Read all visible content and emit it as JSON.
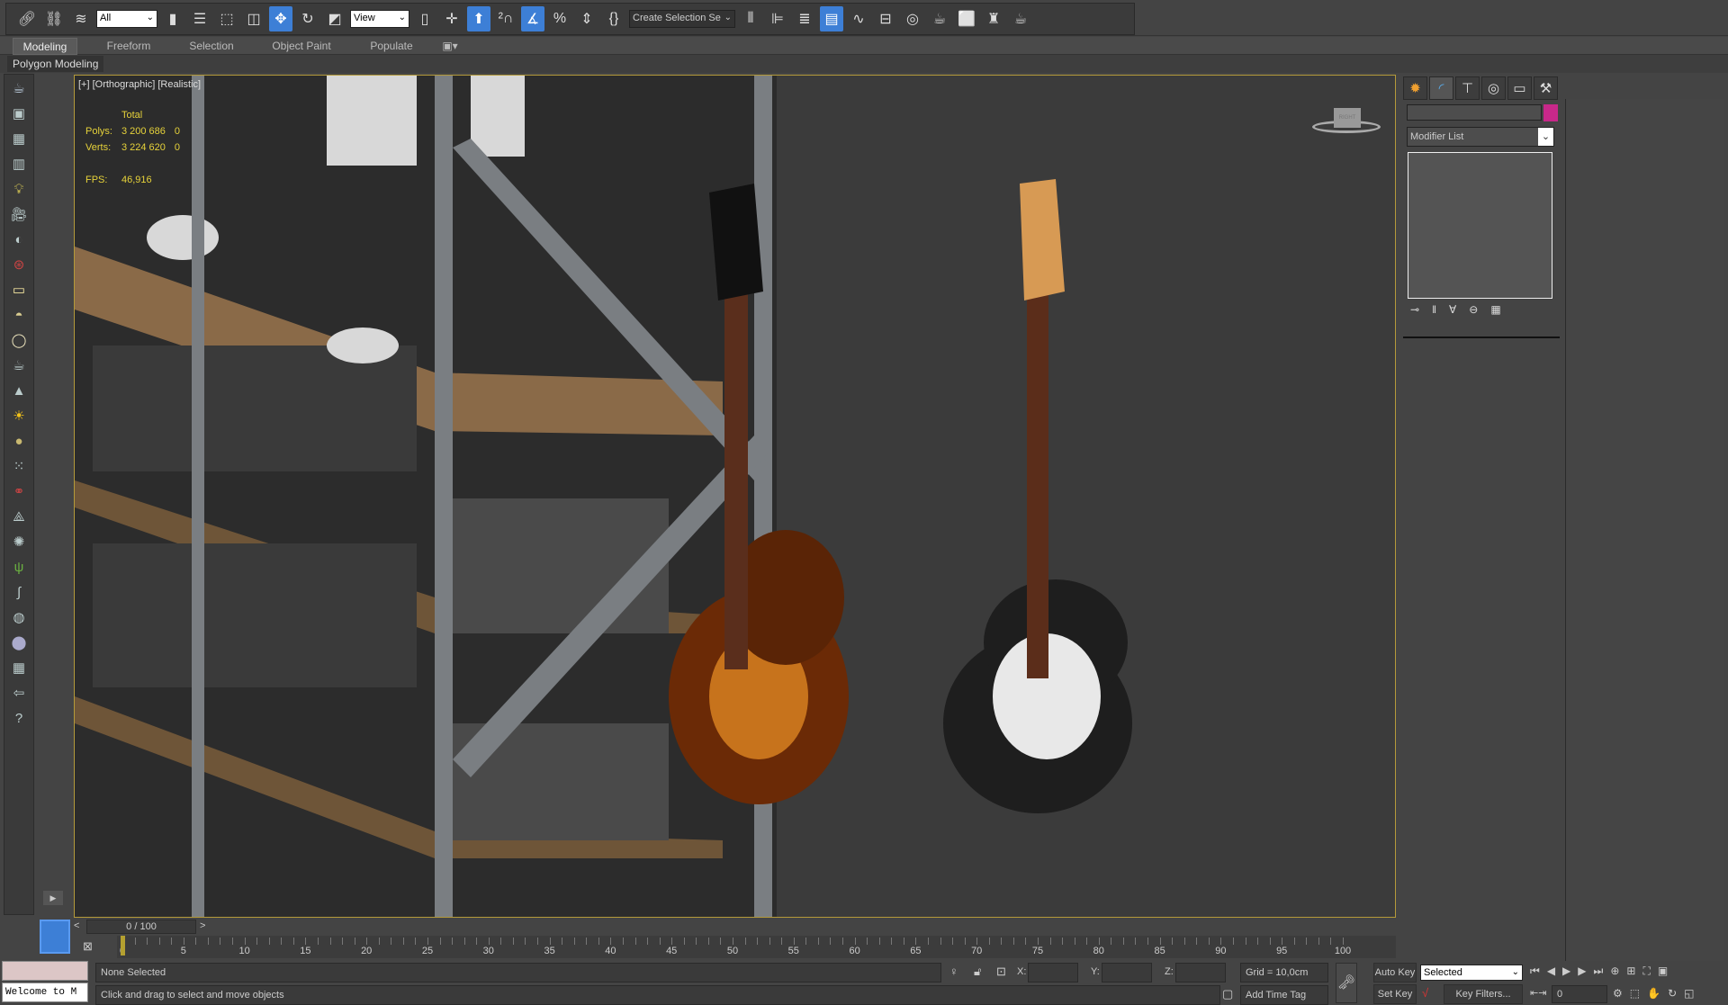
{
  "toolbar": {
    "icons_left": [
      "link-icon",
      "unlink-icon",
      "bind-space-warp-icon"
    ],
    "filter_dropdown": "All",
    "icons_mid": [
      "select-object-icon",
      "select-by-name-icon",
      "rect-selection-icon",
      "window-crossing-icon",
      "move-icon",
      "rotate-icon",
      "scale-icon"
    ],
    "coord_dropdown": "View",
    "icons_snap": [
      "pivot-icon",
      "manipulate-icon",
      "keyboard-shortcut-icon",
      "snap-2d-icon",
      "angle-snap-icon",
      "percent-snap-icon",
      "spinner-snap-icon",
      "edit-named-selection-icon"
    ],
    "named_selection_dropdown": "Create Selection Se",
    "icons_right": [
      "mirror-icon",
      "align-icon",
      "layer-explorer-icon",
      "scene-explorer-icon",
      "curve-editor-icon",
      "schematic-view-icon",
      "material-editor-icon",
      "render-setup-icon",
      "rendered-frame-icon",
      "render-icon",
      "render-iterative-icon"
    ],
    "active_icons": [
      "move-icon",
      "keyboard-shortcut-icon",
      "angle-snap-icon",
      "scene-explorer-icon"
    ]
  },
  "ribbon": {
    "tabs": [
      {
        "label": "Modeling",
        "active": true
      },
      {
        "label": "Freeform"
      },
      {
        "label": "Selection"
      },
      {
        "label": "Object Paint"
      },
      {
        "label": "Populate"
      }
    ],
    "sub_label": "Polygon Modeling"
  },
  "left_bar": {
    "icons": [
      "teapot-icon",
      "render-view-icon",
      "table-icon",
      "table2-icon",
      "light-list-icon",
      "camera-icon",
      "camera-lens-icon",
      "camera-rig-icon",
      "plane-light-icon",
      "dome-light-icon",
      "disc-light-icon",
      "teapot-wire-icon",
      "cone-icon",
      "sun-icon",
      "sphere-light-icon",
      "particles-icon",
      "molecule-icon",
      "bone-icon",
      "foliage-cloud-icon",
      "grass-icon",
      "hair-icon",
      "ox-icon",
      "sphere-icon",
      "material-grid-icon",
      "import-icon",
      "help-icon"
    ]
  },
  "viewport": {
    "label": "[+] [Orthographic] [Realistic]",
    "stats": {
      "header": "Total",
      "polys_label": "Polys:",
      "polys": "3 200 686",
      "polys_sel": "0",
      "verts_label": "Verts:",
      "verts": "3 224 620",
      "verts_sel": "0",
      "fps_label": "FPS:",
      "fps": "46,916"
    },
    "viewcube_label": "RIGHT"
  },
  "command_panel": {
    "tabs": [
      "create-icon",
      "modify-icon",
      "hierarchy-icon",
      "motion-icon",
      "display-icon",
      "utilities-icon"
    ],
    "active_tab": "modify-icon",
    "object_name": "",
    "object_color": "#c8288a",
    "modifier_list": "Modifier List",
    "stack_buttons": [
      "pin-stack-icon",
      "show-end-result-icon",
      "make-unique-icon",
      "remove-modifier-icon",
      "configure-modifier-sets-icon"
    ]
  },
  "timeline": {
    "frame_display": "0 / 100",
    "prev": "<",
    "next": ">",
    "ticks": [
      0,
      5,
      10,
      15,
      20,
      25,
      30,
      35,
      40,
      45,
      50,
      55,
      60,
      65,
      70,
      75,
      80,
      85,
      90,
      95,
      100
    ],
    "current_frame": 0
  },
  "status": {
    "maxscript": "Welcome to M",
    "selection": "None Selected",
    "prompt": "Click and drag to select and move objects",
    "x_label": "X:",
    "y_label": "Y:",
    "z_label": "Z:",
    "x": "",
    "y": "",
    "z": "",
    "grid": "Grid = 10,0cm",
    "add_time_tag": "Add Time Tag",
    "auto_key": "Auto Key",
    "set_key": "Set Key",
    "key_mode": "Selected",
    "key_filters": "Key Filters...",
    "frame": "0"
  }
}
